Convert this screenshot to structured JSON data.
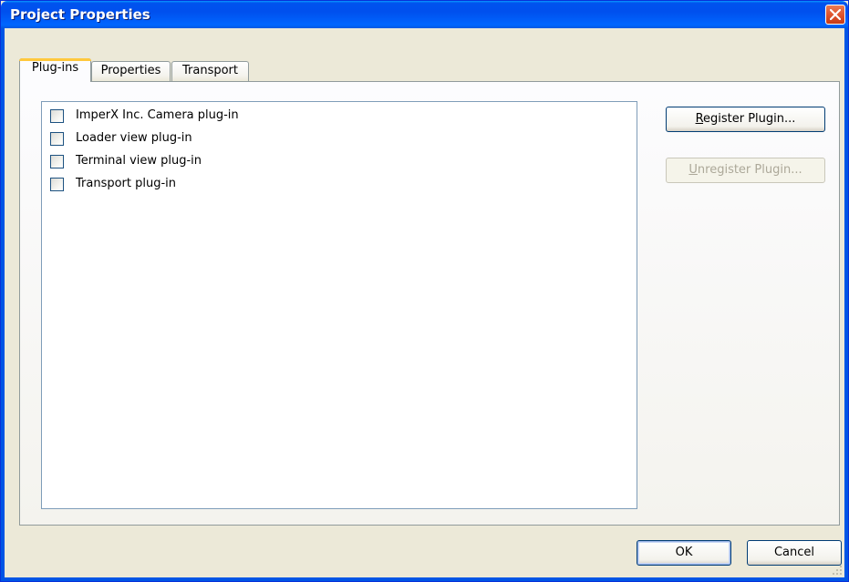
{
  "window": {
    "title": "Project Properties"
  },
  "tabs": [
    {
      "label": "Plug-ins",
      "active": true
    },
    {
      "label": "Properties",
      "active": false
    },
    {
      "label": "Transport",
      "active": false
    }
  ],
  "plugins": [
    {
      "label": "ImperX Inc. Camera plug-in",
      "checked": false
    },
    {
      "label": "Loader view plug-in",
      "checked": false
    },
    {
      "label": "Terminal view plug-in",
      "checked": false
    },
    {
      "label": "Transport plug-in",
      "checked": false
    }
  ],
  "buttons": {
    "register": {
      "label_prefix": "R",
      "label_rest": "egister Plugin...",
      "enabled": true
    },
    "unregister": {
      "label_prefix": "U",
      "label_rest": "nregister Plugin...",
      "enabled": false
    },
    "ok": "OK",
    "cancel": "Cancel"
  },
  "colors": {
    "titlebar": "#0054e3",
    "active_tab_accent": "#ffc83c",
    "close_button": "#e0552f"
  }
}
